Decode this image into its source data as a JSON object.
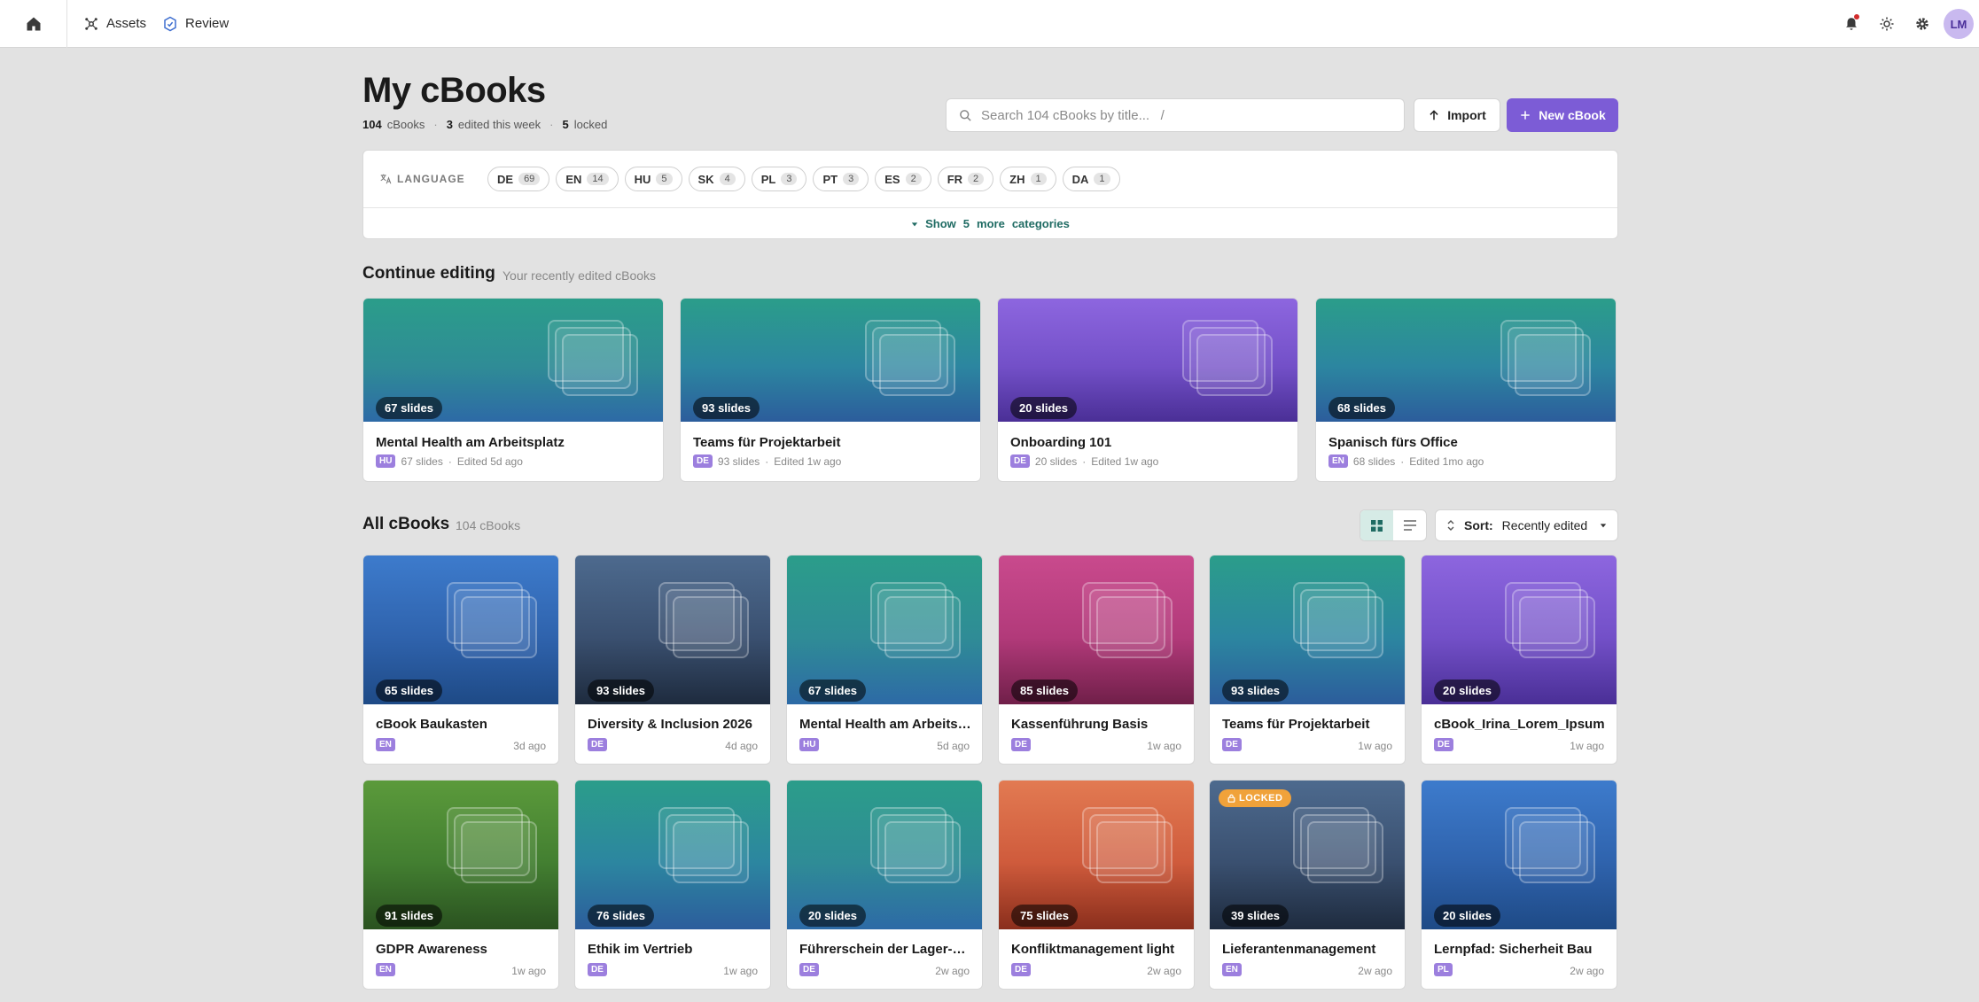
{
  "nav": {
    "items": [
      {
        "label": "Assets",
        "icon": "assets-icon"
      },
      {
        "label": "Review",
        "icon": "review-icon"
      }
    ],
    "avatar": "LM"
  },
  "header": {
    "title": "My cBooks",
    "stats": {
      "count": "104",
      "count_label": "cBooks",
      "edited": "3",
      "edited_label": "edited this week",
      "locked": "5",
      "locked_label": "locked",
      "sep": "·"
    },
    "search_placeholder": "Search 104 cBooks by title...   /",
    "import_label": "Import",
    "new_label": "New cBook"
  },
  "filters": {
    "label": "LANGUAGE",
    "chips": [
      {
        "code": "DE",
        "count": "69"
      },
      {
        "code": "EN",
        "count": "14"
      },
      {
        "code": "HU",
        "count": "5"
      },
      {
        "code": "SK",
        "count": "4"
      },
      {
        "code": "PL",
        "count": "3"
      },
      {
        "code": "PT",
        "count": "3"
      },
      {
        "code": "ES",
        "count": "2"
      },
      {
        "code": "FR",
        "count": "2"
      },
      {
        "code": "ZH",
        "count": "1"
      },
      {
        "code": "DA",
        "count": "1"
      }
    ],
    "more": {
      "show": "Show",
      "count": "5",
      "more": "more",
      "categories": "categories"
    }
  },
  "continue": {
    "title": "Continue editing",
    "subtitle": "Your recently edited cBooks",
    "cards": [
      {
        "title": "Mental Health am Arbeitsplatz",
        "slides_badge": "67 slides",
        "lang": "HU",
        "slides": "67 slides",
        "edited": "Edited 5d ago",
        "theme": "teal"
      },
      {
        "title": "Teams für Projektarbeit",
        "slides_badge": "93 slides",
        "lang": "DE",
        "slides": "93 slides",
        "edited": "Edited 1w ago",
        "theme": "tealblue"
      },
      {
        "title": "Onboarding 101",
        "slides_badge": "20 slides",
        "lang": "DE",
        "slides": "20 slides",
        "edited": "Edited 1w ago",
        "theme": "purple"
      },
      {
        "title": "Spanisch fürs Office",
        "slides_badge": "68 slides",
        "lang": "EN",
        "slides": "68 slides",
        "edited": "Edited 1mo ago",
        "theme": "tealblue"
      }
    ]
  },
  "all": {
    "title": "All cBooks",
    "subtitle": "104 cBooks",
    "sort_label": "Sort:",
    "sort_value": "Recently edited",
    "cards": [
      {
        "title": "cBook Baukasten",
        "slides": "65 slides",
        "lang": "EN",
        "when": "3d ago",
        "theme": "blue",
        "locked": false
      },
      {
        "title": "Diversity & Inclusion 2026",
        "slides": "93 slides",
        "lang": "DE",
        "when": "4d ago",
        "theme": "slate",
        "locked": false
      },
      {
        "title": "Mental Health am Arbeitsp...",
        "slides": "67 slides",
        "lang": "HU",
        "when": "5d ago",
        "theme": "teal",
        "locked": false
      },
      {
        "title": "Kassenführung Basis",
        "slides": "85 slides",
        "lang": "DE",
        "when": "1w ago",
        "theme": "pink",
        "locked": false
      },
      {
        "title": "Teams für Projektarbeit",
        "slides": "93 slides",
        "lang": "DE",
        "when": "1w ago",
        "theme": "tealblue",
        "locked": false
      },
      {
        "title": "cBook_Irina_Lorem_Ipsum",
        "slides": "20 slides",
        "lang": "DE",
        "when": "1w ago",
        "theme": "purple",
        "locked": false
      },
      {
        "title": "GDPR Awareness",
        "slides": "91 slides",
        "lang": "EN",
        "when": "1w ago",
        "theme": "green",
        "locked": false
      },
      {
        "title": "Ethik im Vertrieb",
        "slides": "76 slides",
        "lang": "DE",
        "when": "1w ago",
        "theme": "tealblue",
        "locked": false
      },
      {
        "title": "Führerschein der Lager-Lo...",
        "slides": "20 slides",
        "lang": "DE",
        "when": "2w ago",
        "theme": "teal",
        "locked": false
      },
      {
        "title": "Konfliktmanagement light",
        "slides": "75 slides",
        "lang": "DE",
        "when": "2w ago",
        "theme": "orange",
        "locked": false
      },
      {
        "title": "Lieferantenmanagement",
        "slides": "39 slides",
        "lang": "EN",
        "when": "2w ago",
        "theme": "slate",
        "locked": true
      },
      {
        "title": "Lernpfad: Sicherheit Bau",
        "slides": "20 slides",
        "lang": "PL",
        "when": "2w ago",
        "theme": "blue",
        "locked": false
      }
    ],
    "locked_label": "LOCKED"
  },
  "colors": {
    "accent": "#7c5cd6",
    "link_teal": "#1f6b63",
    "lang_badge": "#9c7fde",
    "locked_badge": "#f0a23a",
    "notification_dot": "#d22c2c"
  }
}
